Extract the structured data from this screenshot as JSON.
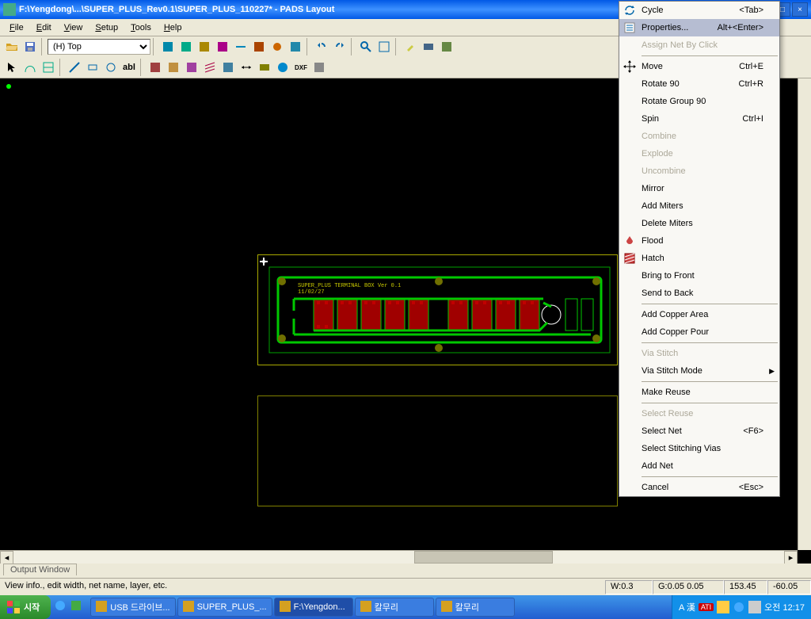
{
  "titlebar": {
    "title": "F:\\Yengdong\\...\\SUPER_PLUS_Rev0.1\\SUPER_PLUS_110227* - PADS Layout"
  },
  "menus": [
    "File",
    "Edit",
    "View",
    "Setup",
    "Tools",
    "Help"
  ],
  "layer_select": {
    "value": "(H) Top"
  },
  "output_tab": "Output Window",
  "status": {
    "hint": "View info., edit width, net name, layer, etc.",
    "w": "W:0.3",
    "g": "G:0.05 0.05",
    "x": "153.45",
    "y": "-60.05"
  },
  "pcb_label": {
    "line1": "SUPER_PLUS TERMINAL BOX Ver 0.1",
    "line2": "11/02/27"
  },
  "context_menu": [
    {
      "type": "item",
      "label": "Cycle",
      "shortcut": "<Tab>",
      "icon": "cycle-icon"
    },
    {
      "type": "item",
      "label": "Properties...",
      "shortcut": "Alt+<Enter>",
      "icon": "properties-icon",
      "highlight": true
    },
    {
      "type": "item",
      "label": "Assign Net By Click",
      "disabled": true
    },
    {
      "type": "sep"
    },
    {
      "type": "item",
      "label": "Move",
      "shortcut": "Ctrl+E",
      "icon": "move-icon"
    },
    {
      "type": "item",
      "label": "Rotate 90",
      "shortcut": "Ctrl+R"
    },
    {
      "type": "item",
      "label": "Rotate Group 90"
    },
    {
      "type": "item",
      "label": "Spin",
      "shortcut": "Ctrl+I"
    },
    {
      "type": "item",
      "label": "Combine",
      "disabled": true
    },
    {
      "type": "item",
      "label": "Explode",
      "disabled": true
    },
    {
      "type": "item",
      "label": "Uncombine",
      "disabled": true
    },
    {
      "type": "item",
      "label": "Mirror"
    },
    {
      "type": "item",
      "label": "Add Miters"
    },
    {
      "type": "item",
      "label": "Delete Miters"
    },
    {
      "type": "item",
      "label": "Flood",
      "icon": "flood-icon"
    },
    {
      "type": "item",
      "label": "Hatch",
      "icon": "hatch-icon"
    },
    {
      "type": "item",
      "label": "Bring to Front"
    },
    {
      "type": "item",
      "label": "Send to Back"
    },
    {
      "type": "sep"
    },
    {
      "type": "item",
      "label": "Add Copper Area"
    },
    {
      "type": "item",
      "label": "Add Copper Pour"
    },
    {
      "type": "sep"
    },
    {
      "type": "item",
      "label": "Via Stitch",
      "disabled": true
    },
    {
      "type": "item",
      "label": "Via Stitch Mode",
      "submenu": true
    },
    {
      "type": "sep"
    },
    {
      "type": "item",
      "label": "Make Reuse"
    },
    {
      "type": "sep"
    },
    {
      "type": "item",
      "label": "Select Reuse",
      "disabled": true
    },
    {
      "type": "item",
      "label": "Select Net",
      "shortcut": "<F6>"
    },
    {
      "type": "item",
      "label": "Select Stitching Vias"
    },
    {
      "type": "item",
      "label": "Add Net"
    },
    {
      "type": "sep"
    },
    {
      "type": "item",
      "label": "Cancel",
      "shortcut": "<Esc>"
    }
  ],
  "taskbar": {
    "start": "시작",
    "tasks": [
      {
        "label": "USB 드라이브..."
      },
      {
        "label": "SUPER_PLUS_..."
      },
      {
        "label": "F:\\Yengdon...",
        "active": true
      },
      {
        "label": "칼무리"
      },
      {
        "label": "칼무리"
      }
    ],
    "tray_ime": "A 漢",
    "tray_time": "오전 12:17"
  },
  "toolbar_icons": {
    "row1": [
      "open",
      "save",
      "sep",
      "layersel",
      "sep",
      "t1",
      "t2",
      "t3",
      "t4",
      "t5",
      "t6",
      "t7",
      "t8",
      "t9",
      "sep",
      "t10",
      "t11",
      "sep",
      "t12",
      "t13",
      "sep",
      "t14",
      "t15",
      "t16",
      "sep",
      "t17",
      "t18"
    ],
    "row2": [
      "d1",
      "d2",
      "d3",
      "sep",
      "d4",
      "d5",
      "d6",
      "sep",
      "d7",
      "d8",
      "sep",
      "d9",
      "d10",
      "d11",
      "d12",
      "d13",
      "d14",
      "d15",
      "d16",
      "d17",
      "d18",
      "d19"
    ]
  }
}
